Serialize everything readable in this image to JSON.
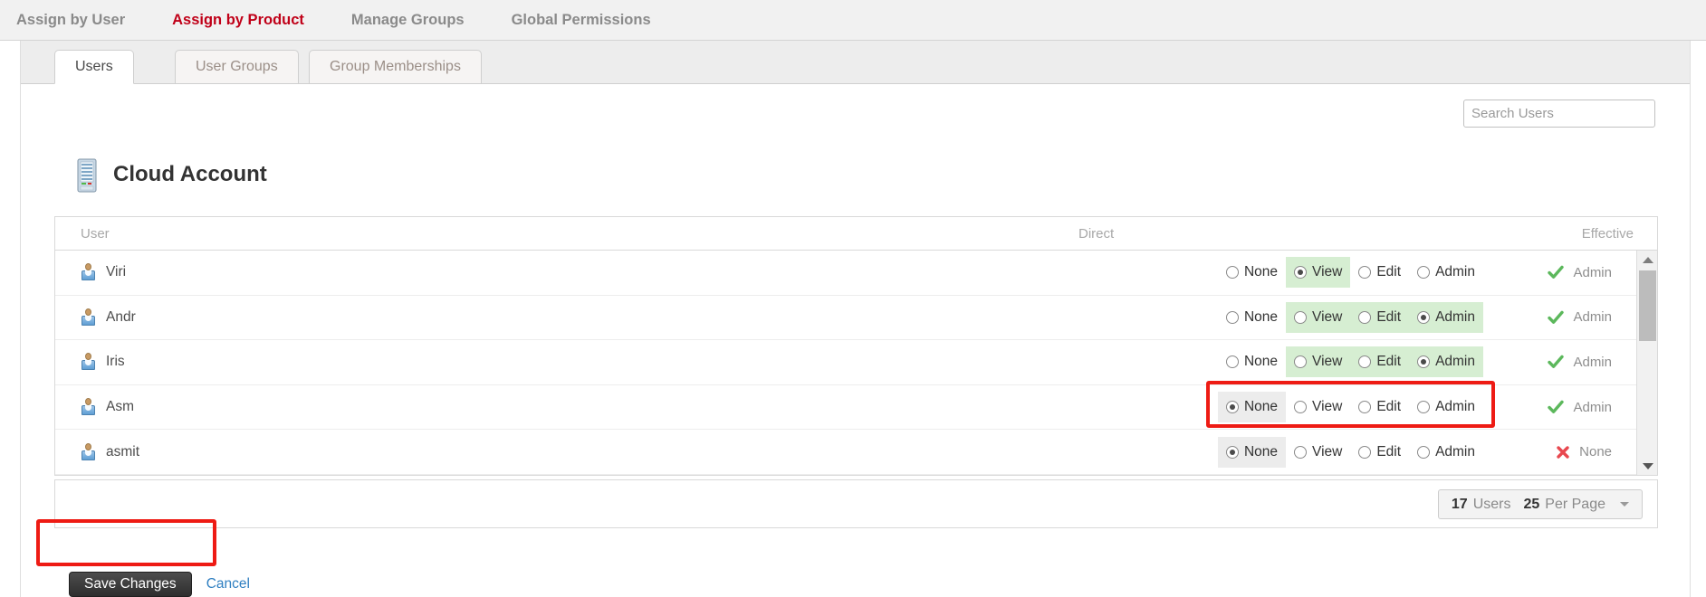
{
  "topnav": {
    "items": [
      {
        "label": "Assign by User",
        "active": false
      },
      {
        "label": "Assign by Product",
        "active": true
      },
      {
        "label": "Manage Groups",
        "active": false
      },
      {
        "label": "Global Permissions",
        "active": false
      }
    ],
    "active_color": "#c00018",
    "inactive_color": "#8a8a8a"
  },
  "tabs": [
    {
      "label": "Users",
      "active": true
    },
    {
      "label": "User Groups",
      "active": false
    },
    {
      "label": "Group Memberships",
      "active": false
    }
  ],
  "header": {
    "title": "Cloud Account",
    "icon": "server-icon"
  },
  "search": {
    "placeholder": "Search Users",
    "value": ""
  },
  "grid": {
    "columns": [
      "User",
      "Direct",
      "Effective"
    ],
    "permission_options": [
      "None",
      "View",
      "Edit",
      "Admin"
    ],
    "rows": [
      {
        "user": "Viri",
        "direct_selected": "View",
        "highlight": "green",
        "highlight_from": "View",
        "highlight_to": "View",
        "effective": "Admin",
        "effective_state": "allowed"
      },
      {
        "user": "Andr",
        "direct_selected": "Admin",
        "highlight": "green",
        "highlight_from": "View",
        "highlight_to": "Admin",
        "effective": "Admin",
        "effective_state": "allowed"
      },
      {
        "user": "Iris",
        "direct_selected": "Admin",
        "highlight": "green",
        "highlight_from": "View",
        "highlight_to": "Admin",
        "effective": "Admin",
        "effective_state": "allowed"
      },
      {
        "user": "Asm",
        "direct_selected": "None",
        "highlight": "gray",
        "highlight_from": "None",
        "highlight_to": "None",
        "effective": "Admin",
        "effective_state": "allowed"
      },
      {
        "user": "asmit",
        "direct_selected": "None",
        "highlight": "gray",
        "highlight_from": "None",
        "highlight_to": "None",
        "effective": "None",
        "effective_state": "denied"
      }
    ]
  },
  "pager": {
    "user_count": "17",
    "users_label": "Users",
    "per_page_count": "25",
    "per_page_label": "Per Page"
  },
  "actions": {
    "save_label": "Save Changes",
    "cancel_label": "Cancel"
  },
  "annotations": {
    "color": "#ee1b14",
    "boxes": [
      "last-row-direct-radios",
      "save-changes-button"
    ]
  },
  "colors": {
    "highlight_green": "#d6eed2",
    "highlight_gray": "#ececec",
    "allowed_check": "#5cb85c",
    "denied_x": "#e8484f",
    "link_blue": "#2f7fc1"
  }
}
